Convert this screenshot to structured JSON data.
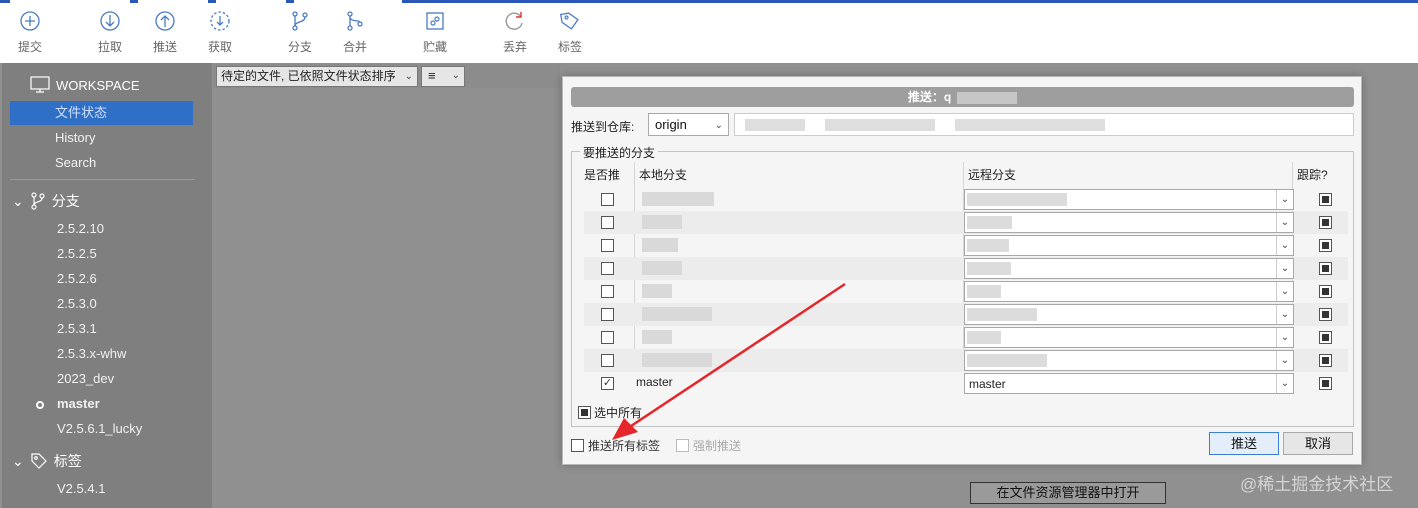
{
  "toolbar": {
    "items": [
      {
        "label": "提交",
        "icon": "plus-circle-icon"
      },
      {
        "label": "拉取",
        "icon": "arrow-down-circle-icon"
      },
      {
        "label": "推送",
        "icon": "arrow-up-circle-icon"
      },
      {
        "label": "获取",
        "icon": "fetch-dashed-circle-icon"
      },
      {
        "label": "分支",
        "icon": "branch-icon"
      },
      {
        "label": "合并",
        "icon": "merge-icon"
      },
      {
        "label": "贮藏",
        "icon": "stash-icon"
      },
      {
        "label": "丢弃",
        "icon": "discard-icon"
      },
      {
        "label": "标签",
        "icon": "tag-icon"
      }
    ]
  },
  "sidebar": {
    "workspace_label": "WORKSPACE",
    "workspace_items": [
      "文件状态",
      "History",
      "Search"
    ],
    "branches_label": "分支",
    "branches": [
      "2.5.2.10",
      "2.5.2.5",
      "2.5.2.6",
      "2.5.3.0",
      "2.5.3.1",
      "2.5.3.x-whw",
      "2023_dev",
      "master",
      "V2.5.6.1_lucky"
    ],
    "current_branch": "master",
    "tags_label": "标签",
    "tags": [
      "V2.5.4.1"
    ]
  },
  "filter": {
    "sort_label": "待定的文件, 已依照文件状态排序",
    "view_label": "≡"
  },
  "background": {
    "open_in_explorer": "在文件资源管理器中打开",
    "watermark": "@稀土掘金技术社区"
  },
  "dialog": {
    "title": "推送：q",
    "push_to_repo_label": "推送到仓库:",
    "repo_value": "origin",
    "branches_legend": "要推送的分支",
    "col_push": "是否推",
    "col_local": "本地分支",
    "col_remote": "远程分支",
    "col_track": "跟踪?",
    "rows": [
      {
        "checked": false,
        "local": "",
        "remote": "",
        "track": true
      },
      {
        "checked": false,
        "local": "",
        "remote": "",
        "track": true
      },
      {
        "checked": false,
        "local": "",
        "remote": "",
        "track": true
      },
      {
        "checked": false,
        "local": "",
        "remote": "",
        "track": true
      },
      {
        "checked": false,
        "local": "",
        "remote": "",
        "track": true
      },
      {
        "checked": false,
        "local": "",
        "remote": "",
        "track": true
      },
      {
        "checked": false,
        "local": "",
        "remote": "",
        "track": true
      },
      {
        "checked": false,
        "local": "",
        "remote": "",
        "track": true
      },
      {
        "checked": true,
        "local": "master",
        "remote": "master",
        "track": true
      }
    ],
    "select_all_label": "选中所有",
    "push_all_tags_label": "推送所有标签",
    "force_push_label": "强制推送",
    "ok_button": "推送",
    "cancel_button": "取消"
  },
  "colors": {
    "accent": "#2f6fc6",
    "annotation_arrow": "#e5262a"
  }
}
